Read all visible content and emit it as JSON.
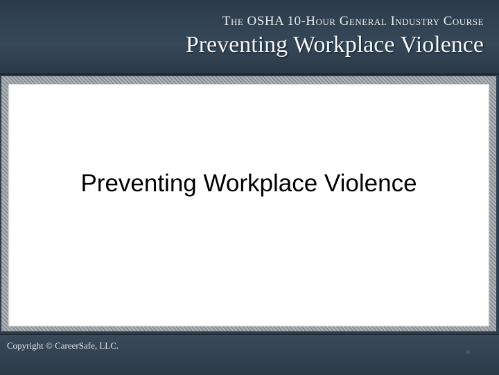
{
  "header": {
    "course": "The OSHA 10-Hour General Industry Course",
    "title": "Preventing Workplace Violence"
  },
  "content": {
    "title": "Preventing Workplace Violence"
  },
  "footer": {
    "copyright": "Copyright © CareerSafe, LLC."
  }
}
